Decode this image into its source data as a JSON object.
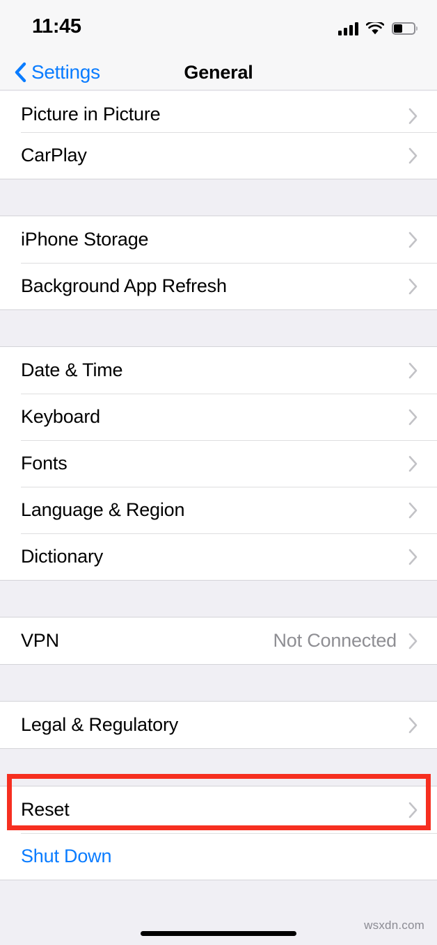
{
  "status_bar": {
    "time": "11:45",
    "cellular_icon": "cellular-bars-icon",
    "wifi_icon": "wifi-icon",
    "battery_icon": "battery-icon",
    "battery_level_percent": 40
  },
  "nav_bar": {
    "back_icon": "chevron-left-icon",
    "back_label": "Settings",
    "title": "General"
  },
  "colors": {
    "accent_blue": "#0a7cff",
    "annotation_red": "#f62f20",
    "value_gray": "#8e8e93",
    "page_background": "#f0eff4"
  },
  "groups": [
    {
      "rows": [
        {
          "label": "Picture in Picture",
          "value": "",
          "accessory": "chevron-right-icon",
          "style": "default",
          "clipped": true
        },
        {
          "label": "CarPlay",
          "value": "",
          "accessory": "chevron-right-icon",
          "style": "default",
          "clipped": false
        }
      ]
    },
    {
      "rows": [
        {
          "label": "iPhone Storage",
          "value": "",
          "accessory": "chevron-right-icon",
          "style": "default",
          "clipped": false
        },
        {
          "label": "Background App Refresh",
          "value": "",
          "accessory": "chevron-right-icon",
          "style": "default",
          "clipped": false
        }
      ]
    },
    {
      "rows": [
        {
          "label": "Date & Time",
          "value": "",
          "accessory": "chevron-right-icon",
          "style": "default",
          "clipped": false
        },
        {
          "label": "Keyboard",
          "value": "",
          "accessory": "chevron-right-icon",
          "style": "default",
          "clipped": false
        },
        {
          "label": "Fonts",
          "value": "",
          "accessory": "chevron-right-icon",
          "style": "default",
          "clipped": false
        },
        {
          "label": "Language & Region",
          "value": "",
          "accessory": "chevron-right-icon",
          "style": "default",
          "clipped": false
        },
        {
          "label": "Dictionary",
          "value": "",
          "accessory": "chevron-right-icon",
          "style": "default",
          "clipped": false
        }
      ]
    },
    {
      "rows": [
        {
          "label": "VPN",
          "value": "Not Connected",
          "accessory": "chevron-right-icon",
          "style": "default",
          "clipped": false
        }
      ]
    },
    {
      "rows": [
        {
          "label": "Legal & Regulatory",
          "value": "",
          "accessory": "chevron-right-icon",
          "style": "default",
          "clipped": false
        }
      ]
    },
    {
      "rows": [
        {
          "label": "Reset",
          "value": "",
          "accessory": "chevron-right-icon",
          "style": "default",
          "clipped": false,
          "highlighted": true
        },
        {
          "label": "Shut Down",
          "value": "",
          "accessory": "none",
          "style": "blue",
          "clipped": false
        }
      ]
    }
  ],
  "annotation": {
    "shape": "rectangle",
    "target_row_label": "Reset",
    "color": "#f62f20"
  },
  "footer": {
    "watermark": "wsxdn.com",
    "home_indicator": "home-indicator"
  }
}
